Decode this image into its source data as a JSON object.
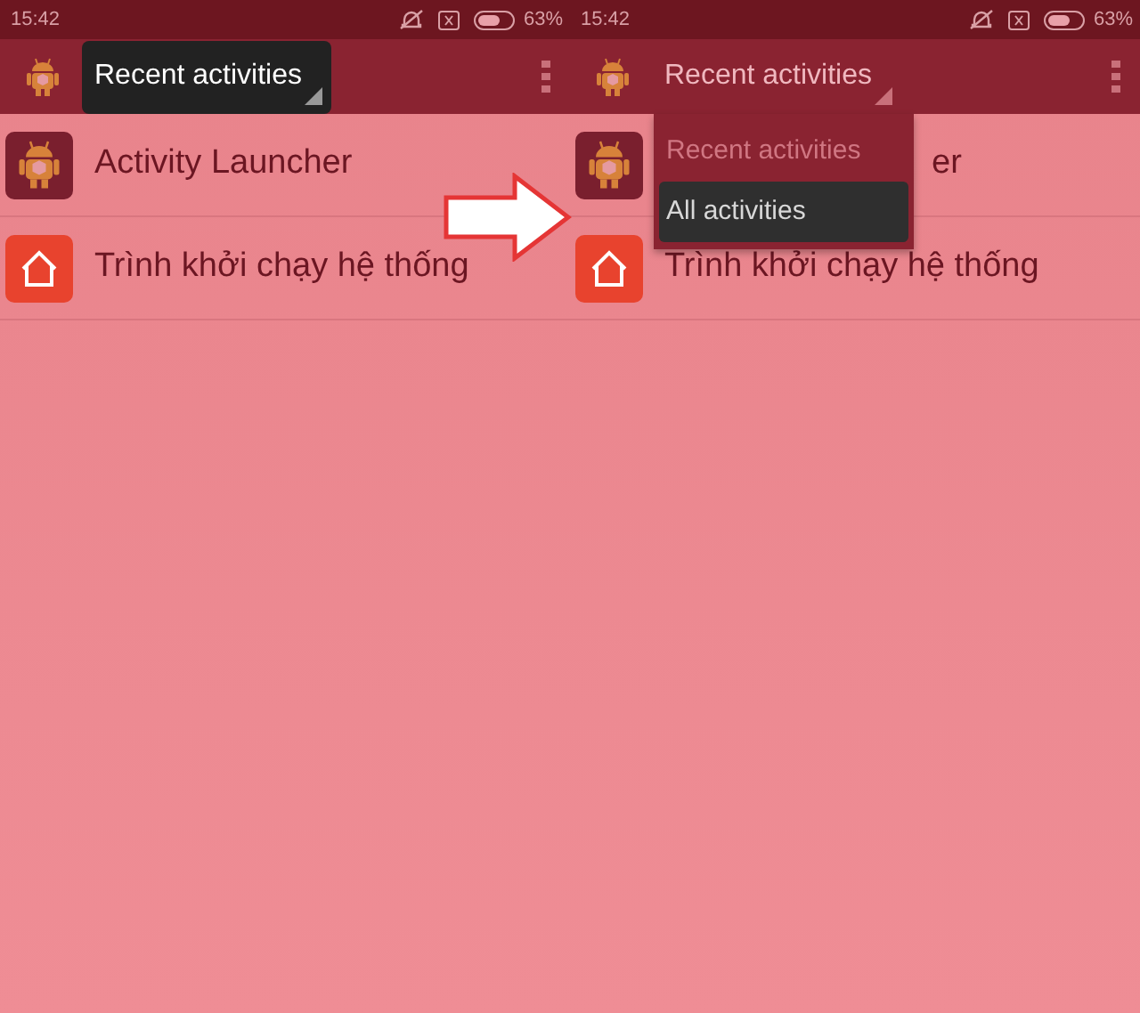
{
  "screens": [
    {
      "status_bar": {
        "time": "15:42",
        "battery": "63%"
      },
      "spinner": {
        "label": "Recent activities",
        "pressed": true
      },
      "list": [
        {
          "kind": "robot",
          "label": "Activity Launcher",
          "clipped": false
        },
        {
          "kind": "home",
          "label": "Trình khởi chạy hệ thống",
          "clipped": false
        }
      ]
    },
    {
      "status_bar": {
        "time": "15:42",
        "battery": "63%"
      },
      "spinner": {
        "label": "Recent activities",
        "pressed": false
      },
      "list": [
        {
          "kind": "robot",
          "label": "er",
          "clipped": true
        },
        {
          "kind": "home",
          "label": "Trình khởi chạy hệ thống",
          "clipped": false
        }
      ],
      "dropdown": [
        {
          "label": "Recent activities",
          "selected": false
        },
        {
          "label": "All activities",
          "selected": true
        }
      ]
    }
  ]
}
